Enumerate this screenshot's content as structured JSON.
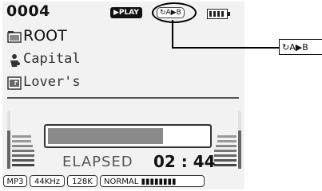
{
  "device": {
    "track_number": "0004",
    "play_state": "▶PLAY",
    "repeat_mode": "↻A▶B",
    "battery_icon": "battery-full-icon",
    "folder": "ROOT",
    "artist": "Capital",
    "title": "Lover's",
    "progress_fraction": 0.72,
    "elapsed_label": "ELAPSED",
    "elapsed_time": "02 : 44",
    "status": {
      "format": "MP3",
      "sample_rate": "44KHz",
      "bitrate": "128K",
      "eq_mode": "NORMAL ▮▮▮▮▮▮▮▮"
    }
  },
  "callout": {
    "label": "↻A▶B"
  },
  "colors": {
    "screen_bg": "#f2f2f2",
    "progress_fill": "#8a8a8a",
    "badge_bg": "#111111"
  }
}
